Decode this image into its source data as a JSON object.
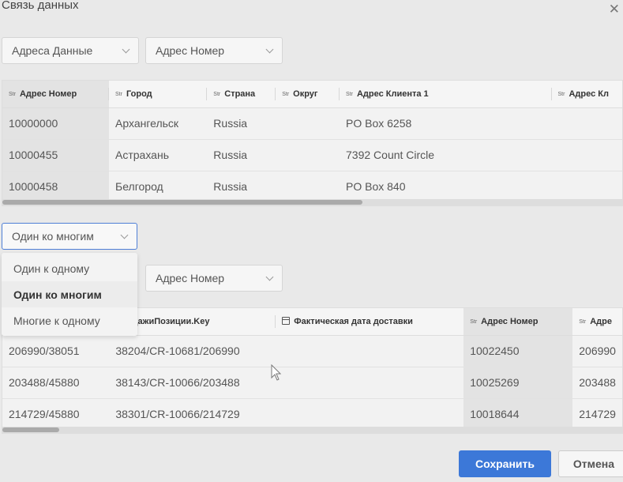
{
  "dialog": {
    "title": "Связь данных",
    "close_icon": "close-icon"
  },
  "top": {
    "source_select": "Адреса Данные",
    "field_select": "Адрес Номер",
    "columns": [
      {
        "icon": "Str",
        "label": "Адрес Номер"
      },
      {
        "icon": "Str",
        "label": "Город"
      },
      {
        "icon": "Str",
        "label": "Страна"
      },
      {
        "icon": "Str",
        "label": "Округ"
      },
      {
        "icon": "Str",
        "label": "Адрес Клиента 1"
      },
      {
        "icon": "Str",
        "label": "Адрес Кл"
      }
    ],
    "rows": [
      [
        "10000000",
        "Архангельск",
        "Russia",
        "",
        "PO Box 6258",
        ""
      ],
      [
        "10000455",
        "Астрахань",
        "Russia",
        "",
        "7392 Count Circle",
        ""
      ],
      [
        "10000458",
        "Белгород",
        "Russia",
        "",
        "PO Box 840",
        ""
      ]
    ]
  },
  "relation": {
    "selected": "Один ко многим",
    "options": [
      "Один к одному",
      "Один ко многим",
      "Многие к одному"
    ]
  },
  "bottom": {
    "field_select": "Адрес Номер",
    "columns": [
      {
        "icon": "",
        "label": ""
      },
      {
        "icon": "",
        "label": "ПродажиПозиции.Key"
      },
      {
        "icon": "calendar",
        "label": "Фактическая дата доставки"
      },
      {
        "icon": "Str",
        "label": "Адрес Номер"
      },
      {
        "icon": "Str",
        "label": "Адре"
      }
    ],
    "rows": [
      [
        "206990/38051",
        "38204/CR-10681/206990",
        "",
        "10022450",
        "206990"
      ],
      [
        "203488/45880",
        "38143/CR-10066/203488",
        "",
        "10025269",
        "203488"
      ],
      [
        "214729/45880",
        "38301/CR-10066/214729",
        "",
        "10018644",
        "214729"
      ]
    ]
  },
  "buttons": {
    "save": "Сохранить",
    "cancel": "Отмена"
  },
  "colors": {
    "primary": "#3c78d8",
    "focus_border": "#4f7fd6"
  }
}
